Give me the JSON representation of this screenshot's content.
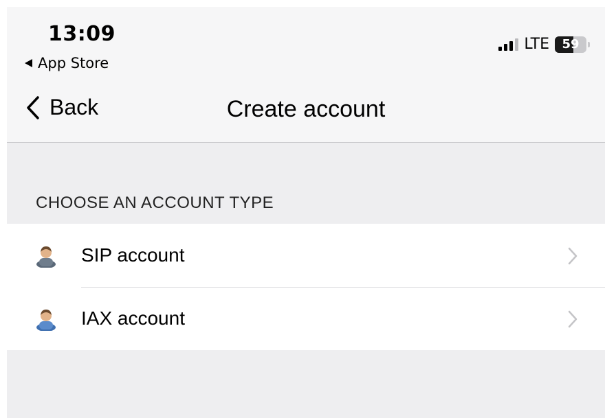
{
  "status_bar": {
    "time": "13:09",
    "back_app": "App Store",
    "network": "LTE",
    "battery_level": 59,
    "battery_label": "59"
  },
  "nav": {
    "back_label": "Back",
    "title": "Create account"
  },
  "section": {
    "header": "CHOOSE AN ACCOUNT TYPE",
    "items": [
      {
        "label": "SIP account",
        "icon": "user-avatar-icon"
      },
      {
        "label": "IAX account",
        "icon": "user-avatar-icon"
      }
    ]
  },
  "colors": {
    "background": "#eeeef0",
    "bar": "#f6f6f7",
    "chevron": "#c4c4c7"
  }
}
